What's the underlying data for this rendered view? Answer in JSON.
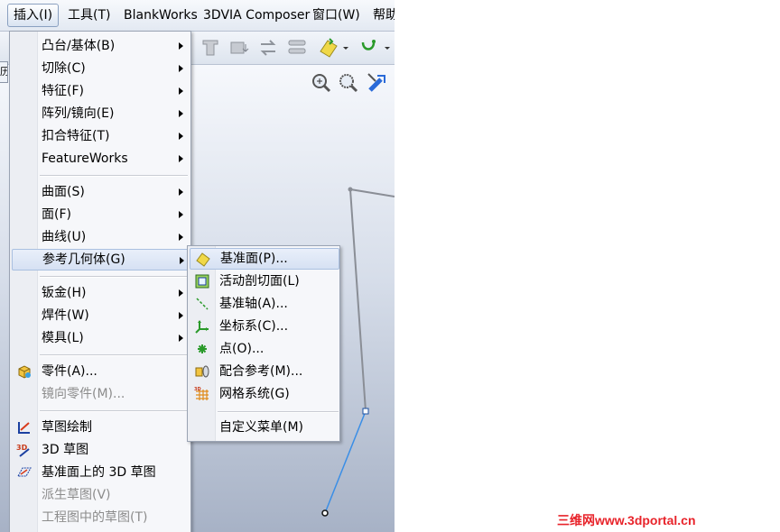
{
  "menubar": {
    "items": [
      "插入(I)",
      "工具(T)",
      "BlankWorks",
      "3DVIA Composer",
      "窗口(W)",
      "帮助"
    ]
  },
  "edge_tab": "历",
  "insert_menu": {
    "items": [
      {
        "label": "凸台/基体(B)",
        "submenu": true
      },
      {
        "label": "切除(C)",
        "submenu": true
      },
      {
        "label": "特征(F)",
        "submenu": true
      },
      {
        "label": "阵列/镜向(E)",
        "submenu": true
      },
      {
        "label": "扣合特征(T)",
        "submenu": true
      },
      {
        "label": "FeatureWorks",
        "submenu": true
      },
      {
        "label": "曲面(S)",
        "submenu": true
      },
      {
        "label": "面(F)",
        "submenu": true
      },
      {
        "label": "曲线(U)",
        "submenu": true
      },
      {
        "label": "参考几何体(G)",
        "submenu": true,
        "highlighted": true
      },
      {
        "label": "钣金(H)",
        "submenu": true
      },
      {
        "label": "焊件(W)",
        "submenu": true
      },
      {
        "label": "模具(L)",
        "submenu": true
      },
      {
        "label": "零件(A)...",
        "icon": "part-icon"
      },
      {
        "label": "镜向零件(M)...",
        "disabled": true
      },
      {
        "label": "草图绘制",
        "icon": "sketch-icon"
      },
      {
        "label": "3D 草图",
        "icon": "3d-sketch-icon"
      },
      {
        "label": "基准面上的 3D 草图",
        "icon": "3d-sketch-on-plane-icon"
      },
      {
        "label": "派生草图(V)",
        "disabled": true
      },
      {
        "label": "工程图中的草图(T)",
        "disabled": true
      }
    ]
  },
  "reference_geometry_menu": {
    "items": [
      {
        "label": "基准面(P)...",
        "icon": "plane-icon"
      },
      {
        "label": "活动剖切面(L)",
        "icon": "live-section-plane-icon"
      },
      {
        "label": "基准轴(A)...",
        "icon": "axis-icon"
      },
      {
        "label": "坐标系(C)...",
        "icon": "coordinate-system-icon"
      },
      {
        "label": "点(O)...",
        "icon": "point-icon"
      },
      {
        "label": "配合参考(M)...",
        "icon": "mate-reference-icon"
      },
      {
        "label": "网格系统(G)",
        "icon": "grid-system-icon"
      },
      {
        "label": "自定义菜单(M)"
      }
    ]
  },
  "watermark": "三维网www.3dportal.cn",
  "colors": {
    "accent": "#2a6ad8",
    "watermark": "#e8232a",
    "sketch_line": "#3a8ee6"
  }
}
